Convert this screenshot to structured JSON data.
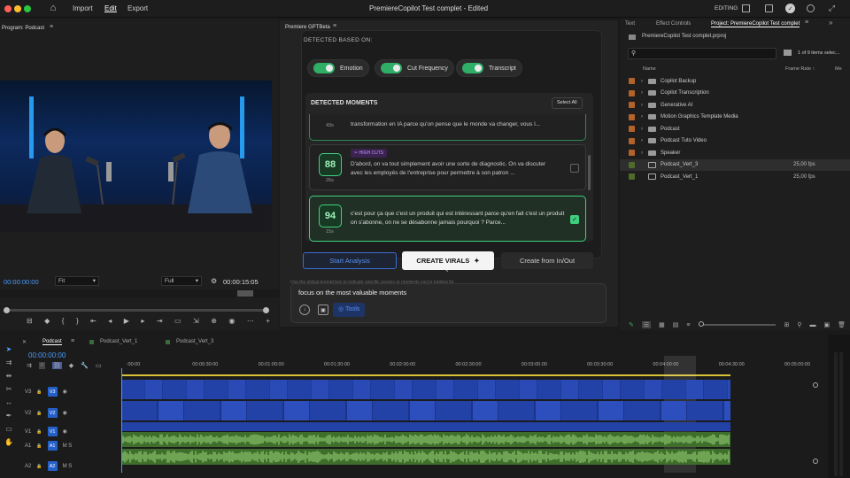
{
  "topbar": {
    "home_icon": "home-icon",
    "menu": [
      "Import",
      "Edit",
      "Export"
    ],
    "title": "PremiereCopilot Test complet - Edited",
    "workspace": "EDITING",
    "right_icons": [
      "share-icon",
      "fullscreen-icon",
      "check-icon",
      "progress-icon",
      "expand-icon"
    ]
  },
  "program": {
    "title": "Program: Podcast",
    "timecode": "00:00:00:00",
    "fit": "Fit",
    "quality": "Full",
    "duration": "00:00:15:05"
  },
  "plugin": {
    "tab": "Premiere GPTBeta",
    "detected_based_on": "DETECTED BASED ON:",
    "toggles": [
      "Emotion",
      "Cut Frequency",
      "Transcript"
    ],
    "moments_title": "DETECTED MOMENTS",
    "select_all": "Select All",
    "partial_card": {
      "time": "43s",
      "text": "transformation en IA parce qu'on pense que le monde va changer, vous l..."
    },
    "cards": [
      {
        "score": "88",
        "time": "26s",
        "badge": "HIGH CUTS",
        "text": "D'abord, on va tout simplement avoir une sorte de diagnostic. On va discuter avec les employés de l'entreprise pour permettre à son patron ...",
        "checked": false
      },
      {
        "score": "94",
        "time": "15s",
        "badge": "",
        "text": "c'est pour ça que c'est un produit qui est intéressant parce qu'en fait c'est un produit on s'abonne, on ne se désabonne jamais pourquoi ? Parce...",
        "checked": true
      }
    ],
    "buttons": {
      "start": "Start Analysis",
      "create": "CREATE VIRALS",
      "from_inout": "Create from In/Out"
    },
    "hint": "Use the global prompt box to indicate specific scenes or moments you're looking for",
    "prompt": "focus on the most valuable moments",
    "tools": "Tools"
  },
  "project": {
    "tabs": [
      "Text",
      "Effect Controls",
      "Project: PremiereCopilot Test complet"
    ],
    "file": "PremiereCopilot Test complet.prproj",
    "items_count": "1 of 9 items selec...",
    "columns": [
      "Name",
      "Frame Rate",
      "Me"
    ],
    "rows": [
      {
        "name": "Copilot Backup",
        "type": "folder",
        "color": "#b3632a",
        "fps": ""
      },
      {
        "name": "Copilot Transcription",
        "type": "folder",
        "color": "#b3632a",
        "fps": ""
      },
      {
        "name": "Generative AI",
        "type": "folder",
        "color": "#b3632a",
        "fps": ""
      },
      {
        "name": "Motion Graphics Template Media",
        "type": "folder",
        "color": "#b3632a",
        "fps": ""
      },
      {
        "name": "Podcast",
        "type": "folder",
        "color": "#b3632a",
        "fps": ""
      },
      {
        "name": "Podcast Tuto Video",
        "type": "folder",
        "color": "#b3632a",
        "fps": ""
      },
      {
        "name": "Speaker",
        "type": "folder",
        "color": "#b3632a",
        "fps": ""
      },
      {
        "name": "Podcast_Vert_3",
        "type": "sequence",
        "color": "#4e6b2c",
        "fps": "25,00 fps"
      },
      {
        "name": "Podcast_Vert_1",
        "type": "sequence",
        "color": "#4e6b2c",
        "fps": "25,00 fps"
      }
    ]
  },
  "timeline": {
    "tabs": [
      "Podcast",
      "Podcast_Vert_1",
      "Podcast_Vert_3"
    ],
    "timecode": "00:00:00:00",
    "ruler": [
      ":00:00",
      "00:00:30:00",
      "00:01:00:00",
      "00:01:30:00",
      "00:02:00:00",
      "00:02:30:00",
      "00:03:00:00",
      "00:03:30:00",
      "00:04:00:00",
      "00:04:30:00",
      "00:05:00:00"
    ],
    "tracks": [
      "V3",
      "V2",
      "V1",
      "A1",
      "A2"
    ]
  }
}
